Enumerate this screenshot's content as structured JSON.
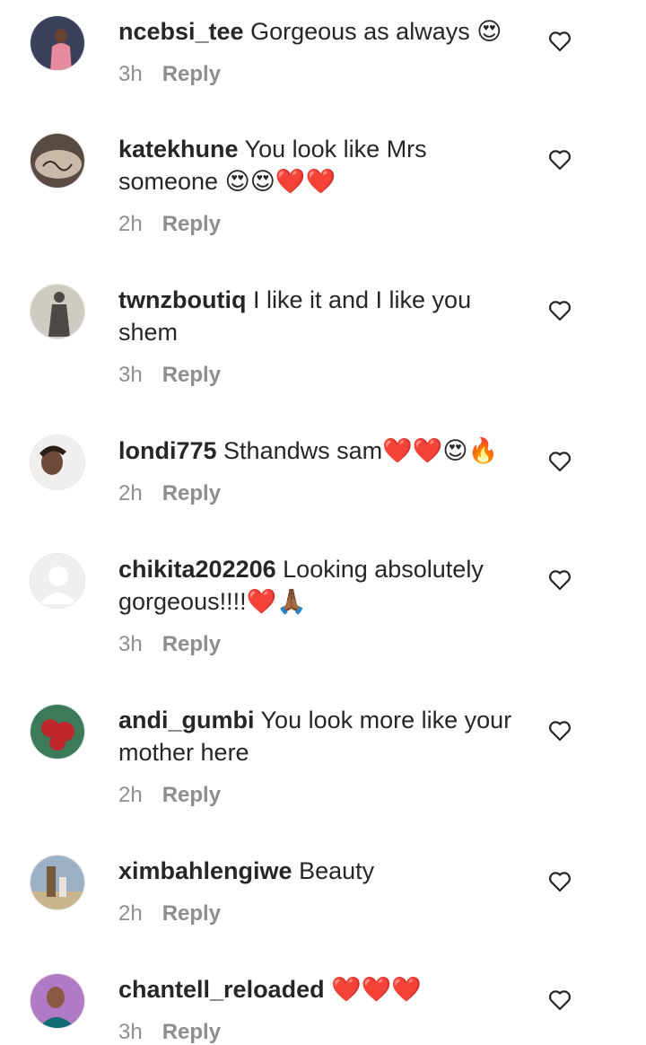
{
  "comments": [
    {
      "username": "ncebsi_tee",
      "text": "Gorgeous as always 😍",
      "time": "3h",
      "reply": "Reply",
      "avatar_bg": "#3a3f5c",
      "avatar_accent": "#e78aa0"
    },
    {
      "username": "katekhune",
      "text": "You look like Mrs someone 😍😍❤️❤️",
      "time": "2h",
      "reply": "Reply",
      "avatar_bg": "#5a4a44",
      "avatar_accent": "#c9b9a8"
    },
    {
      "username": "twnzboutiq",
      "text": "I like it and I like you shem",
      "time": "3h",
      "reply": "Reply",
      "avatar_bg": "#cfcac2",
      "avatar_accent": "#4d4a46"
    },
    {
      "username": "londi775",
      "text": "Sthandws sam❤️❤️😍🔥",
      "time": "2h",
      "reply": "Reply",
      "avatar_bg": "#f1eeee",
      "avatar_accent": "#6b4a3a"
    },
    {
      "username": "chikita202206",
      "text": "Looking absolutely gorgeous!!!!❤️🙏🏾",
      "time": "3h",
      "reply": "Reply",
      "avatar_bg": "#efefef",
      "avatar_accent": "#ffffff"
    },
    {
      "username": "andi_gumbi",
      "text": "You look more like your mother here",
      "time": "2h",
      "reply": "Reply",
      "avatar_bg": "#3c7a5a",
      "avatar_accent": "#c0272d"
    },
    {
      "username": "ximbahlengiwe",
      "text": "Beauty",
      "time": "2h",
      "reply": "Reply",
      "avatar_bg": "#9bb0c6",
      "avatar_accent": "#7a5a3c"
    },
    {
      "username": "chantell_reloaded",
      "text": "❤️❤️❤️",
      "time": "3h",
      "reply": "Reply",
      "avatar_bg": "#b07ac4",
      "avatar_accent": "#0f6b73"
    }
  ],
  "colors": {
    "text": "#262626",
    "meta": "#8e8e8e"
  },
  "icons": {
    "like": "heart-outline-icon"
  }
}
